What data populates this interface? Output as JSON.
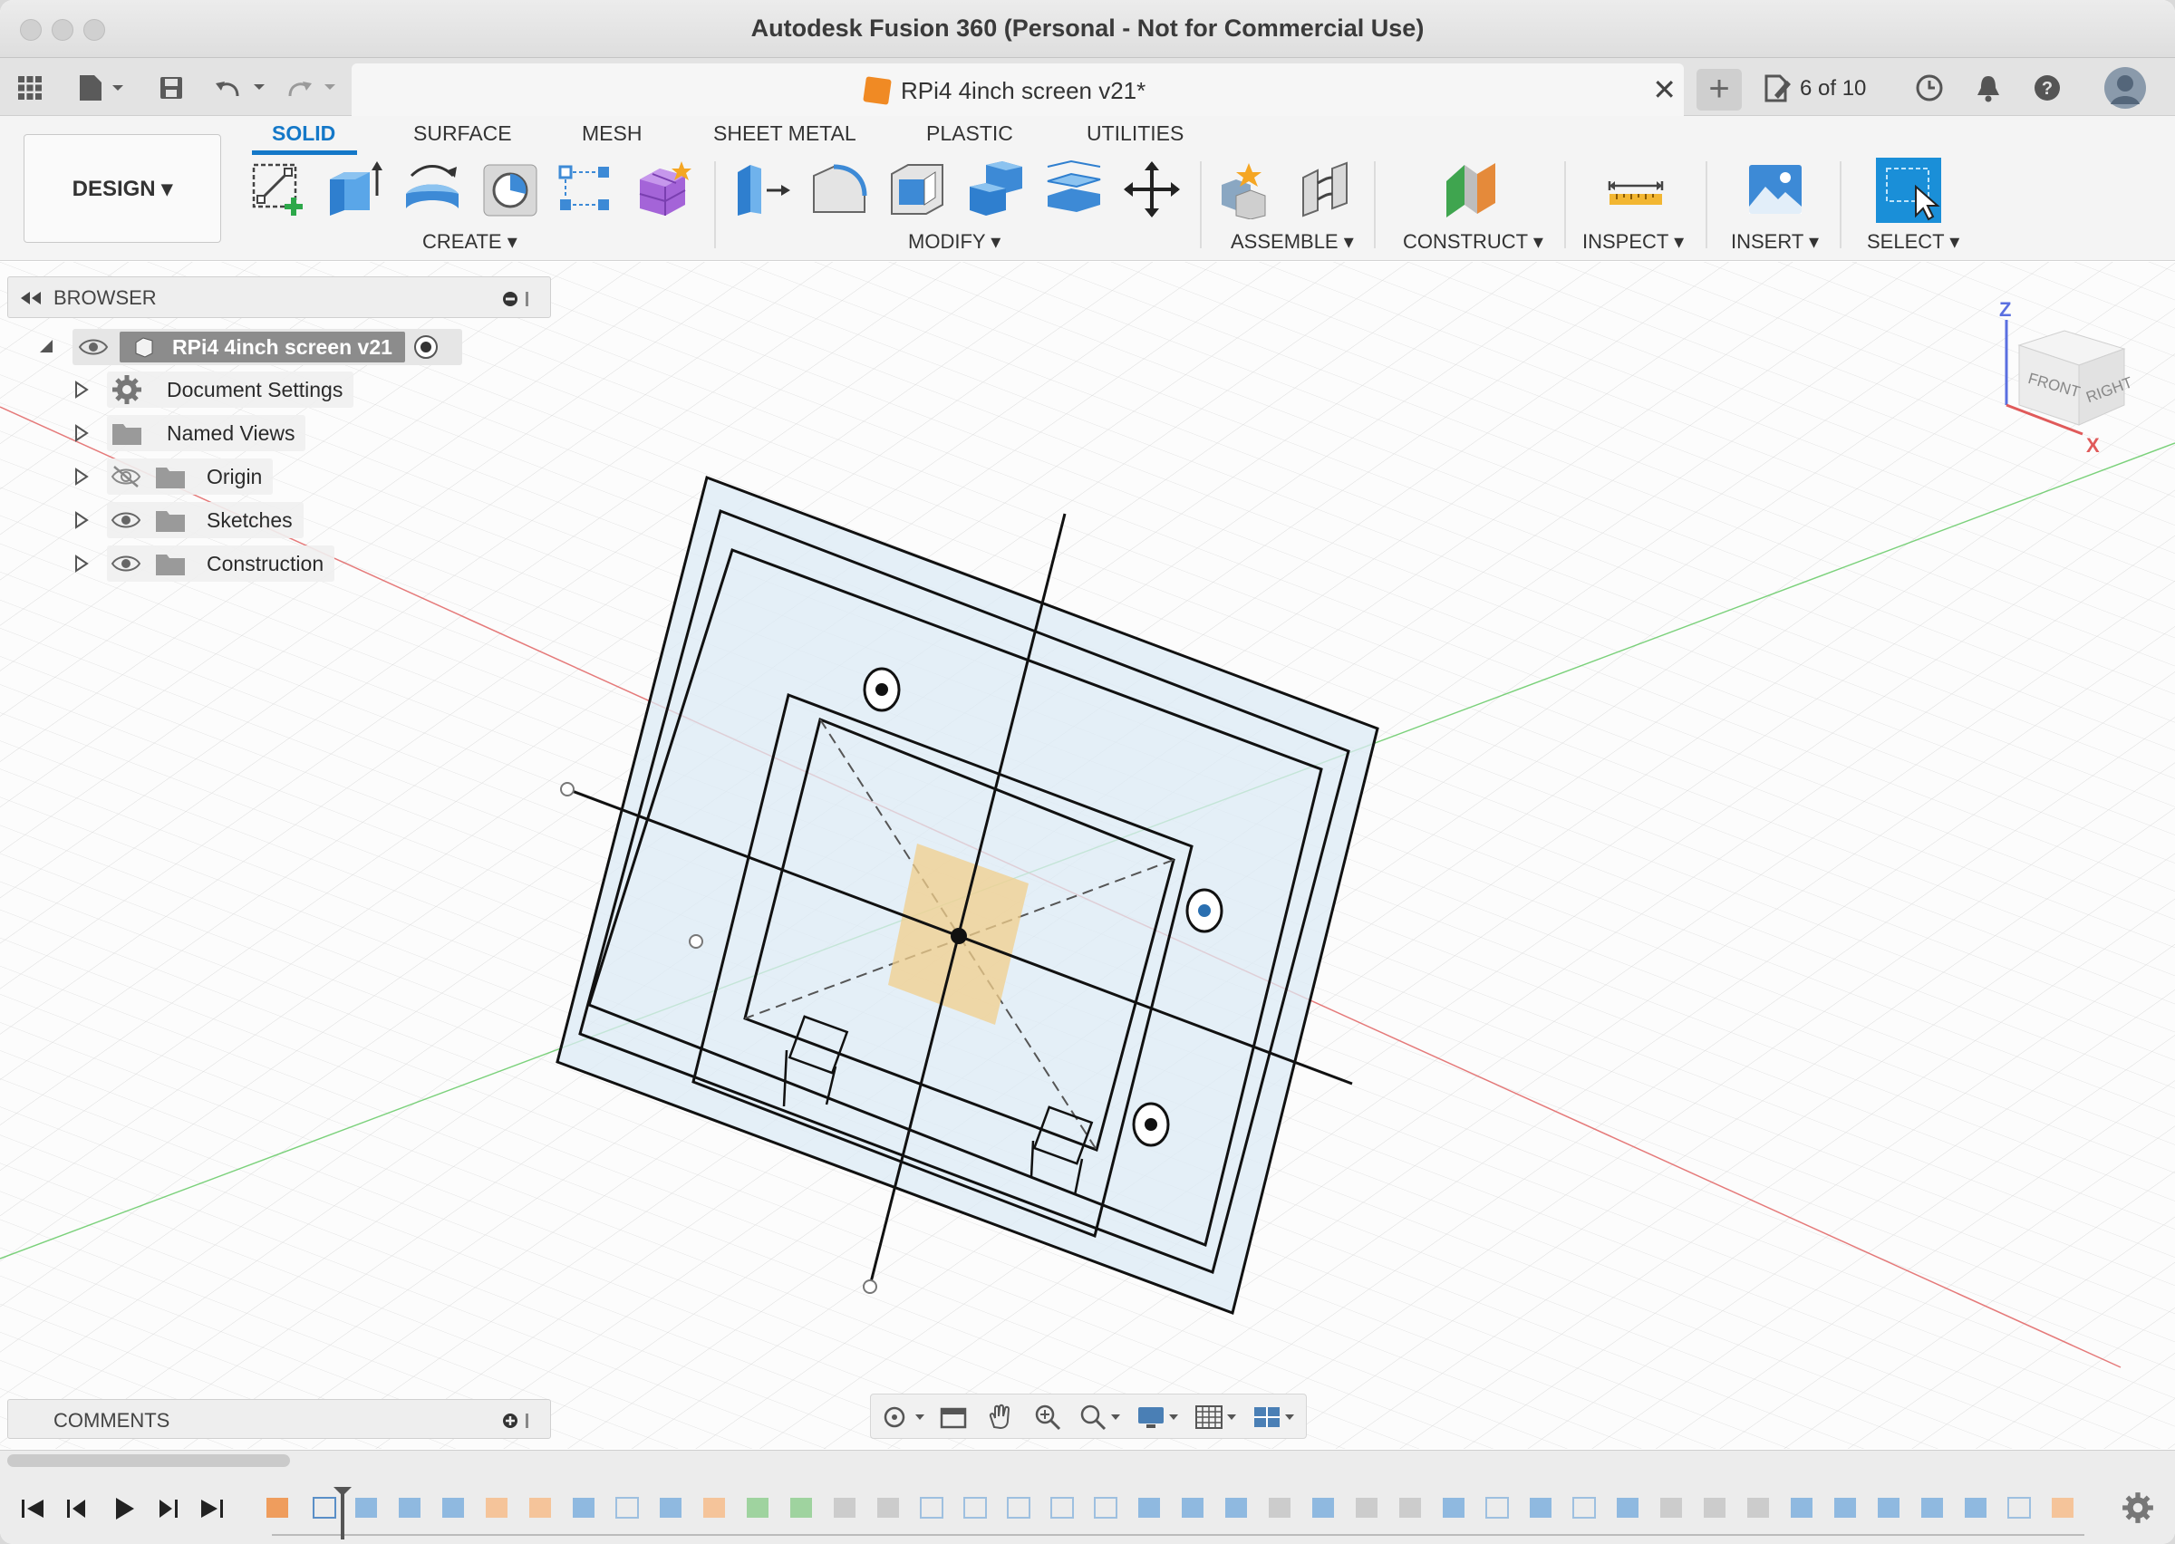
{
  "window": {
    "title": "Autodesk Fusion 360 (Personal - Not for Commercial Use)"
  },
  "approw": {
    "document_tab": "RPi4 4inch screen v21*",
    "close_glyph": "✕",
    "new_tab_glyph": "+",
    "steps_label": "6 of 10"
  },
  "ribbon": {
    "workspace": "DESIGN ▾",
    "tabs": [
      "SOLID",
      "SURFACE",
      "MESH",
      "SHEET METAL",
      "PLASTIC",
      "UTILITIES"
    ],
    "active_tab": "SOLID",
    "groups": [
      "CREATE ▾",
      "MODIFY ▾",
      "ASSEMBLE ▾",
      "CONSTRUCT ▾",
      "INSPECT ▾",
      "INSERT ▾",
      "SELECT ▾"
    ]
  },
  "browser": {
    "header": "BROWSER",
    "root": "RPi4 4inch screen v21",
    "items": [
      {
        "label": "Document Settings",
        "icon": "gear-icon"
      },
      {
        "label": "Named Views",
        "icon": "folder-icon"
      },
      {
        "label": "Origin",
        "icon": "folder-icon",
        "visible": false
      },
      {
        "label": "Sketches",
        "icon": "folder-icon",
        "visible": true
      },
      {
        "label": "Construction",
        "icon": "folder-icon",
        "visible": true
      }
    ]
  },
  "comments": {
    "header": "COMMENTS"
  },
  "viewcube": {
    "front": "FRONT",
    "right": "RIGHT",
    "z_axis": "Z",
    "x_axis": "X"
  },
  "colors": {
    "accent": "#1478c8",
    "x_axis": "#e05a5a",
    "y_axis": "#5cc75c",
    "sketch_fill": "#dcebf5",
    "selection_patch": "#f2cf8c"
  }
}
